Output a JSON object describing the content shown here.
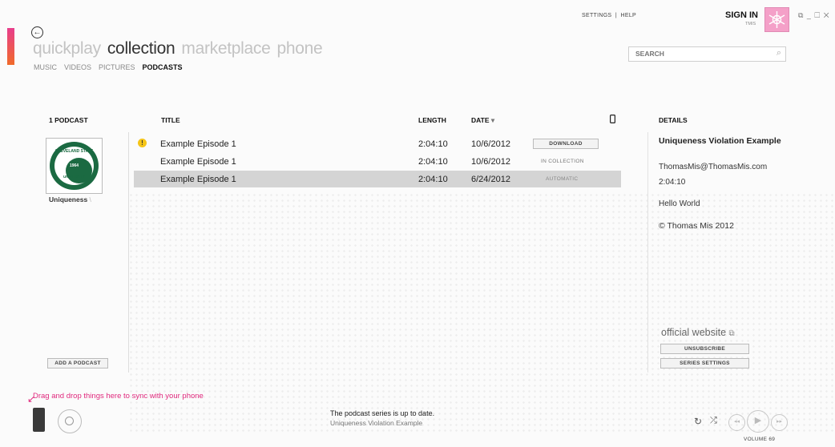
{
  "window": {
    "top_links": "SETTINGS  |  HELP",
    "sign_in": "SIGN IN",
    "sign_in_sub": "TMIS",
    "window_controls": "⧉ _ ☐ ✕"
  },
  "nav": {
    "pivots": [
      "quickplay",
      "collection",
      "marketplace",
      "phone"
    ],
    "active_pivot": "collection",
    "subnav": [
      "MUSIC",
      "VIDEOS",
      "PICTURES",
      "PODCASTS"
    ],
    "active_subnav": "PODCASTS"
  },
  "search": {
    "placeholder": "SEARCH"
  },
  "podcast_list": {
    "header": "1 PODCAST",
    "name": "Uniqueness",
    "name_fade": " \\",
    "add_button": "ADD A PODCAST",
    "art_text": [
      "CLEVELAND STATE",
      "UNIVERSITY",
      "1964"
    ]
  },
  "episodes": {
    "columns": {
      "title": "TITLE",
      "length": "LENGTH",
      "date": "DATE",
      "sort_arrow": "▾"
    },
    "rows": [
      {
        "title": "Example Episode 1",
        "length": "2:04:10",
        "date": "10/6/2012",
        "status": "DOWNLOAD",
        "status_kind": "button",
        "warning": "!"
      },
      {
        "title": "Example Episode 1",
        "length": "2:04:10",
        "date": "10/6/2012",
        "status": "IN COLLECTION",
        "status_kind": "text"
      },
      {
        "title": "Example Episode 1",
        "length": "2:04:10",
        "date": "6/24/2012",
        "status": "AUTOMATIC",
        "status_kind": "text",
        "selected": true
      }
    ]
  },
  "details": {
    "header": "DETAILS",
    "title": "Uniqueness Violation Example",
    "email": "ThomasMis@ThomasMis.com",
    "length": "2:04:10",
    "description": "Hello World",
    "copyright": "© Thomas Mis 2012",
    "official_website": "official website",
    "unsubscribe": "UNSUBSCRIBE",
    "series_settings": "SERIES SETTINGS"
  },
  "footer": {
    "drag_hint": "Drag and drop things here to sync with your phone",
    "status_line1": "The podcast series is up to date.",
    "status_line2": "Uniqueness Violation Example",
    "volume": "VOLUME 69"
  },
  "colors": {
    "accent": "#e0297d",
    "avatar": "#f4a0c8",
    "seal_green": "#1b6a42"
  }
}
